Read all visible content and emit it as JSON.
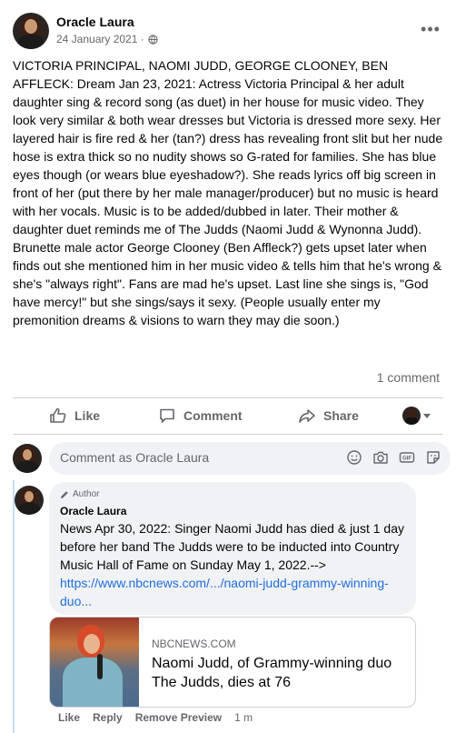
{
  "post": {
    "author": "Oracle Laura",
    "date": "24 January 2021 · ",
    "privacy_icon": "globe-icon",
    "text": "VICTORIA PRINCIPAL, NAOMI JUDD, GEORGE CLOONEY, BEN AFFLECK: Dream Jan 23, 2021: Actress Victoria Principal & her adult daughter sing & record song (as duet) in her house for music video. They look very similar & both wear dresses but Victoria is dressed more sexy. Her layered hair is fire red & her (tan?) dress has revealing front slit but her nude hose is extra thick so no nudity shows so G-rated for families. She has blue eyes though (or wears blue eyeshadow?). She reads lyrics off big screen in front of her (put there by her male manager/producer) but no music is heard with her vocals. Music is to be added/dubbed in later. Their mother & daughter duet reminds me of The Judds (Naomi Judd & Wynonna Judd). Brunette male actor George Clooney (Ben Affleck?) gets upset later when finds out she mentioned him in her music video & tells him that he's wrong & she's \"always right\". Fans are mad he's upset. Last line she sings is, \"God have mercy!\" but she sings/says it sexy. (People usually enter my premonition dreams & visions to warn they may die soon.)",
    "comment_count": "1 comment"
  },
  "actions": {
    "like": "Like",
    "comment": "Comment",
    "share": "Share"
  },
  "composer": {
    "placeholder": "Comment as Oracle Laura",
    "icons": [
      "emoji-icon",
      "camera-icon",
      "gif-icon",
      "sticker-icon"
    ]
  },
  "comment": {
    "badge": "Author",
    "author": "Oracle Laura",
    "text": "News Apr 30, 2022: Singer Naomi Judd has died & just 1 day before her band The Judds were to be inducted into Country Music Hall of Fame on Sunday May 1, 2022.-->",
    "link": "https://www.nbcnews.com/.../naomi-judd-grammy-winning-duo...",
    "preview": {
      "domain": "NBCNEWS.COM",
      "title": "Naomi Judd, of Grammy-winning duo The Judds, dies at 76"
    },
    "like": "Like",
    "reply": "Reply",
    "remove_preview": "Remove Preview",
    "time": "1 m"
  }
}
